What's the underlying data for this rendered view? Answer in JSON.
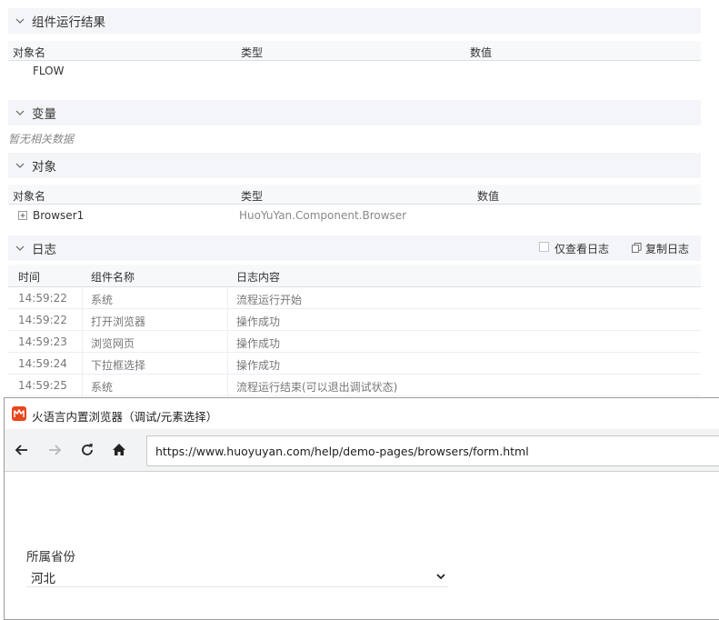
{
  "sections": {
    "results": {
      "title": "组件运行结果",
      "col_name": "对象名",
      "col_type": "类型",
      "col_value": "数值",
      "row_name": "FLOW"
    },
    "variables": {
      "title": "变量",
      "empty": "暂无相关数据"
    },
    "objects": {
      "title": "对象",
      "col_name": "对象名",
      "col_type": "类型",
      "col_value": "数值",
      "row_name": "Browser1",
      "row_type": "HuoYuYan.Component.Browser"
    },
    "log": {
      "title": "日志",
      "only_log_label": "仅查看日志",
      "copy_log_label": "复制日志",
      "col_time": "时间",
      "col_component": "组件名称",
      "col_content": "日志内容",
      "rows": [
        {
          "time": "14:59:22",
          "component": "系统",
          "content": "流程运行开始"
        },
        {
          "time": "14:59:22",
          "component": "打开浏览器",
          "content": "操作成功"
        },
        {
          "time": "14:59:23",
          "component": "浏览网页",
          "content": "操作成功"
        },
        {
          "time": "14:59:24",
          "component": "下拉框选择",
          "content": "操作成功"
        },
        {
          "time": "14:59:25",
          "component": "系统",
          "content": "流程运行结束(可以退出调试状态)"
        }
      ]
    }
  },
  "browser": {
    "window_title": "火语言内置浏览器（调试/元素选择）",
    "url": "https://www.huoyuyan.com/help/demo-pages/browsers/form.html",
    "form": {
      "province_label": "所属省份",
      "province_value": "河北"
    }
  },
  "icons": {
    "collapse": "chevron-down-icon",
    "expand_row": "plus-square-icon",
    "copy": "copy-icon",
    "back": "arrow-left-icon",
    "forward": "arrow-right-icon",
    "reload": "reload-icon",
    "home": "home-icon",
    "app_logo": "huoyuyan-logo-icon"
  },
  "colors": {
    "section_header_bg": "#f4f5f8",
    "logo": "#e8471e"
  }
}
